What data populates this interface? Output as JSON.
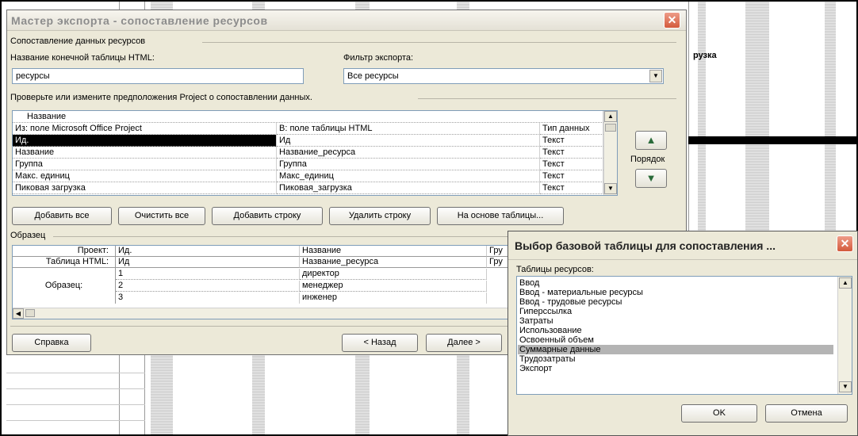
{
  "background": {
    "visible_text": "рузка"
  },
  "export_wizard": {
    "title": "Мастер экспорта - сопоставление ресурсов",
    "close_label": "✕",
    "group_resource_mapping": "Сопоставление данных ресурсов",
    "dest_table_label": "Название конечной таблицы HTML:",
    "dest_table_value": "ресурсы",
    "filter_label": "Фильтр экспорта:",
    "filter_value": "Все ресурсы",
    "verify_label": "Проверьте или измените предположения Project о сопоставлении данных.",
    "mapping_table": {
      "edit_cell": "Название",
      "headers": [
        "Из: поле Microsoft Office Project",
        "В: поле таблицы HTML",
        "Тип данных"
      ],
      "rows": [
        [
          "Ид.",
          "Ид",
          "Текст"
        ],
        [
          "Название",
          "Название_ресурса",
          "Текст"
        ],
        [
          "Группа",
          "Группа",
          "Текст"
        ],
        [
          "Макс. единиц",
          "Макс_единиц",
          "Текст"
        ],
        [
          "Пиковая загрузка",
          "Пиковая_загрузка",
          "Текст"
        ]
      ]
    },
    "order_label": "Порядок",
    "buttons": {
      "add_all": "Добавить все",
      "clear_all": "Очистить все",
      "add_row": "Добавить строку",
      "delete_row": "Удалить строку",
      "based_on_table": "На основе таблицы..."
    },
    "sample_group": "Образец",
    "sample_table": {
      "project_label": "Проект:",
      "html_table_label": "Таблица HTML:",
      "sample_label": "Образец:",
      "project_row": [
        "Ид.",
        "Название",
        "Гру"
      ],
      "html_row": [
        "Ид",
        "Название_ресурса",
        "Гру"
      ],
      "sample_ids": [
        "1",
        "2",
        "3"
      ],
      "sample_names": [
        "директор",
        "менеджер",
        "инженер"
      ]
    },
    "footer": {
      "help": "Справка",
      "back": "< Назад",
      "next": "Далее >"
    }
  },
  "base_table_dialog": {
    "title": "Выбор базовой таблицы для сопоставления ...",
    "close_label": "✕",
    "list_label": "Таблицы ресурсов:",
    "items": [
      "Ввод",
      "Ввод - материальные ресурсы",
      "Ввод - трудовые ресурсы",
      "Гиперссылка",
      "Затраты",
      "Использование",
      "Освоенный объем",
      "Суммарные данные",
      "Трудозатраты",
      "Экспорт"
    ],
    "selected_item": "Суммарные данные",
    "ok": "OK",
    "cancel": "Отмена"
  }
}
